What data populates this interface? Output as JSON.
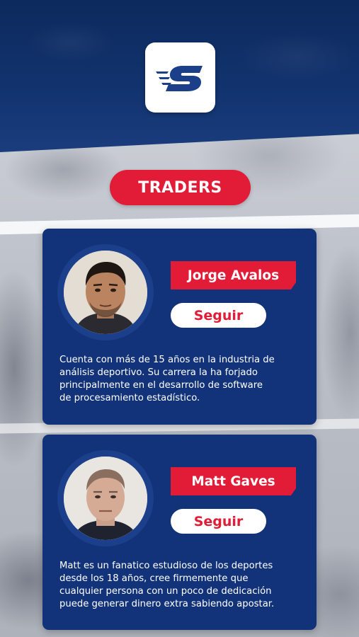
{
  "header": {
    "logo_icon": "speed-s-logo-icon"
  },
  "section_title": "TRADERS",
  "traders": [
    {
      "name": "Jorge Avalos",
      "follow_label": "Seguir",
      "bio_lines": [
        "Cuenta con más de 15 años en la industria de",
        "análisis deportivo. Su carrera la ha forjado",
        "principalmente en el desarrollo de software",
        "de procesamiento estadístico."
      ]
    },
    {
      "name": "Matt Gaves",
      "follow_label": "Seguir",
      "bio_lines": [
        "Matt es un fanatico estudioso de los deportes",
        "desde los 18 años, cree firmemente que",
        "cualquier persona con un poco de dedicación",
        "puede generar dinero extra sabiendo apostar."
      ]
    }
  ],
  "colors": {
    "navy": "#12337a",
    "header_navy": "#0d2a5e",
    "accent_red": "#e21b36",
    "white": "#ffffff"
  }
}
